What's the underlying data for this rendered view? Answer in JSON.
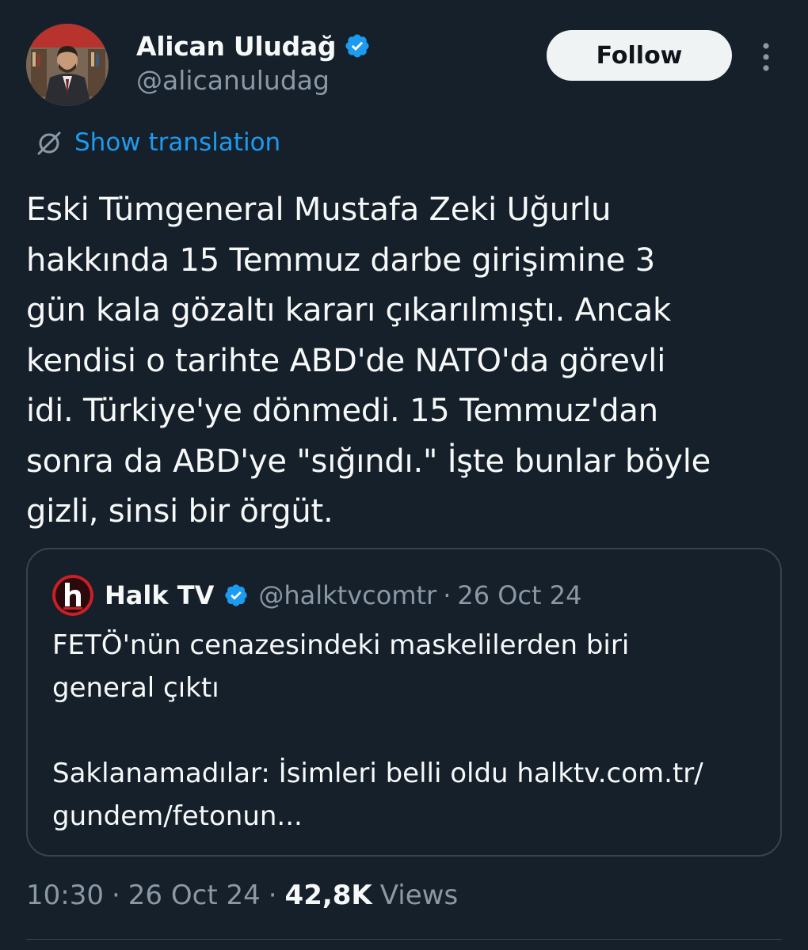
{
  "author": {
    "display_name": "Alican Uludağ",
    "handle": "@alicanuludag",
    "verified": true
  },
  "actions": {
    "follow_label": "Follow",
    "more_icon": "more-vertical-icon"
  },
  "translation": {
    "label": "Show translation",
    "icon": "translate-icon"
  },
  "tweet": {
    "text": "Eski Tümgeneral Mustafa Zeki Uğurlu\nhakkında 15 Temmuz darbe girişimine 3\ngün kala gözaltı kararı çıkarılmıştı. Ancak\nkendisi o tarihte ABD'de NATO'da görevli\nidi. Türkiye'ye dönmedi. 15 Temmuz'dan\nsonra da ABD'ye \"sığındı.\" İşte bunlar böyle\ngizli, sinsi bir örgüt."
  },
  "quote": {
    "display_name": "Halk TV",
    "handle": "@halktvcomtr",
    "separator": "·",
    "date": "26 Oct 24",
    "verified": true,
    "paragraph1_line1": "FETÖ'nün cenazesindeki maskelilerden biri",
    "paragraph1_line2": "general çıktı",
    "paragraph2_line1": "Saklanamadılar: İsimleri belli oldu halktv.com.tr/",
    "paragraph2_line2": "gundem/fetonun..."
  },
  "footer": {
    "time": "10:30",
    "separator": "·",
    "date": "26 Oct 24",
    "views_count": "42,8K",
    "views_label": "Views"
  },
  "colors": {
    "background": "#15202b",
    "text": "#f7f9f9",
    "secondary_text": "#8b98a5",
    "accent": "#1d9bf0",
    "border": "#38444d",
    "follow_bg": "#eff3f4"
  }
}
